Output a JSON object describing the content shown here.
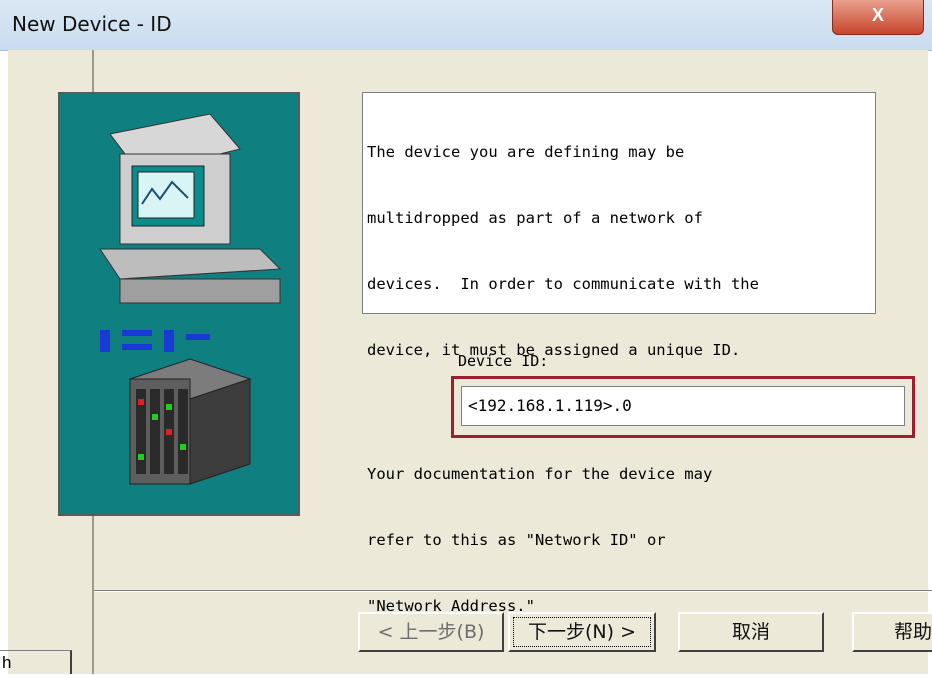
{
  "window": {
    "title": "New Device - ID",
    "close_label": "X"
  },
  "description": {
    "lines": [
      "The device you are defining may be",
      "multidropped as part of a network of",
      "devices.  In order to communicate with the",
      "device, it must be assigned a unique ID."
    ],
    "lines2": [
      "Your documentation for the device may",
      "refer to this as \"Network ID\" or",
      "\"Network Address.\""
    ]
  },
  "device_id": {
    "label": "Device ID:",
    "value": "<192.168.1.119>.0"
  },
  "buttons": {
    "back": "< 上一步(B)",
    "next": "下一步(N) >",
    "cancel": "取消",
    "help": "帮助"
  },
  "left_stub": {
    "label": "h"
  },
  "colors": {
    "art_background": "#0f7f80",
    "highlight_border": "#9b1f2e",
    "dialog_face": "#ece9d8"
  }
}
